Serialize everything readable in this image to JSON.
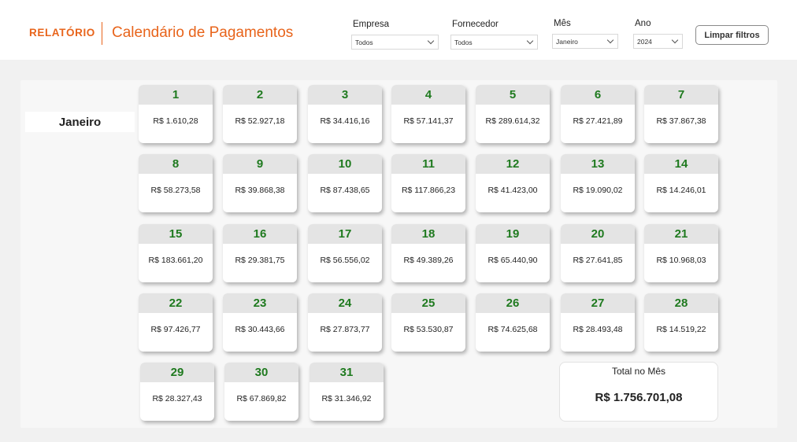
{
  "header": {
    "brand": "RELATÓRIO",
    "title": "Calendário de Pagamentos"
  },
  "filters": {
    "empresa": {
      "label": "Empresa",
      "value": "Todos"
    },
    "fornecedor": {
      "label": "Fornecedor",
      "value": "Todos"
    },
    "mes": {
      "label": "Mês",
      "value": "Janeiro"
    },
    "ano": {
      "label": "Ano",
      "value": "2024"
    },
    "clear_label": "Limpar filtros"
  },
  "calendar": {
    "month": "Janeiro",
    "days": [
      {
        "day": "1",
        "amount": "R$ 1.610,28"
      },
      {
        "day": "2",
        "amount": "R$ 52.927,18"
      },
      {
        "day": "3",
        "amount": "R$ 34.416,16"
      },
      {
        "day": "4",
        "amount": "R$ 57.141,37"
      },
      {
        "day": "5",
        "amount": "R$ 289.614,32"
      },
      {
        "day": "6",
        "amount": "R$ 27.421,89"
      },
      {
        "day": "7",
        "amount": "R$ 37.867,38"
      },
      {
        "day": "8",
        "amount": "R$ 58.273,58"
      },
      {
        "day": "9",
        "amount": "R$ 39.868,38"
      },
      {
        "day": "10",
        "amount": "R$ 87.438,65"
      },
      {
        "day": "11",
        "amount": "R$ 117.866,23"
      },
      {
        "day": "12",
        "amount": "R$ 41.423,00"
      },
      {
        "day": "13",
        "amount": "R$ 19.090,02"
      },
      {
        "day": "14",
        "amount": "R$ 14.246,01"
      },
      {
        "day": "15",
        "amount": "R$ 183.661,20"
      },
      {
        "day": "16",
        "amount": "R$ 29.381,75"
      },
      {
        "day": "17",
        "amount": "R$ 56.556,02"
      },
      {
        "day": "18",
        "amount": "R$ 49.389,26"
      },
      {
        "day": "19",
        "amount": "R$ 65.440,90"
      },
      {
        "day": "20",
        "amount": "R$ 27.641,85"
      },
      {
        "day": "21",
        "amount": "R$ 10.968,03"
      },
      {
        "day": "22",
        "amount": "R$ 97.426,77"
      },
      {
        "day": "23",
        "amount": "R$ 30.443,66"
      },
      {
        "day": "24",
        "amount": "R$ 27.873,77"
      },
      {
        "day": "25",
        "amount": "R$ 53.530,87"
      },
      {
        "day": "26",
        "amount": "R$ 74.625,68"
      },
      {
        "day": "27",
        "amount": "R$ 28.493,48"
      },
      {
        "day": "28",
        "amount": "R$ 14.519,22"
      },
      {
        "day": "29",
        "amount": "R$ 28.327,43"
      },
      {
        "day": "30",
        "amount": "R$ 67.869,82"
      },
      {
        "day": "31",
        "amount": "R$ 31.346,92"
      }
    ],
    "total_label": "Total no Mês",
    "total_value": "R$ 1.756.701,08"
  }
}
